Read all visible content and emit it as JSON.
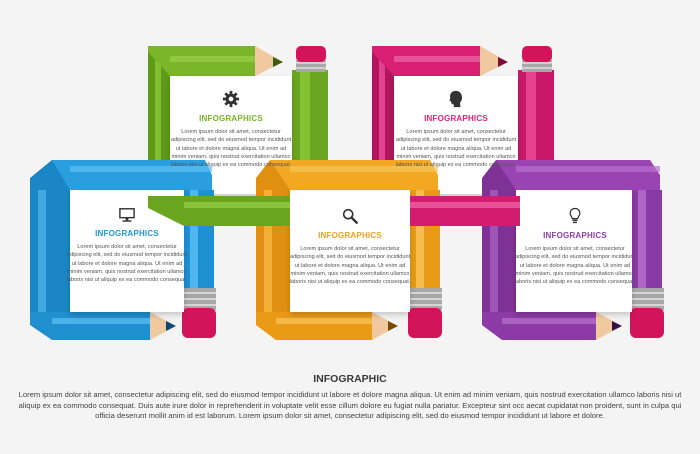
{
  "colors": {
    "green": "#78b428",
    "pink": "#e0207a",
    "blue": "#1f96d8",
    "orange": "#f0a020",
    "purple": "#8e3da8",
    "eraser": "#d4145a",
    "metal": "#a8a8a8",
    "wood": "#f1c9a0"
  },
  "cards": [
    {
      "id": "green",
      "icon": "gear-icon",
      "title": "INFOGRAPHICS",
      "text": "Lorem ipsum dolor sit amet, consectetur adipiscing elit, sed do eiusmod tempor incididunt ut labore et dolore magna aliqua. Ut enim ad minim veniam, quis nostrud exercitation ullamco laboris nisi ut aliquip ex ea commodo consequat."
    },
    {
      "id": "pink",
      "icon": "person-head-icon",
      "title": "INFOGRAPHICS",
      "text": "Lorem ipsum dolor sit amet, consectetur adipiscing elit, sed do eiusmod tempor incididunt ut labore et dolore magna aliqua. Ut enim ad minim veniam, quis nostrud exercitation ullamco laboris nisi ut aliquip ex ea commodo consequat."
    },
    {
      "id": "blue",
      "icon": "monitor-icon",
      "title": "INFOGRAPHICS",
      "text": "Lorem ipsum dolor sit amet, consectetur adipiscing elit, sed do eiusmod tempor incididunt ut labore et dolore magna aliqua. Ut enim ad minim veniam, quis nostrud exercitation ullamco laboris nisi ut aliquip ex ea commodo consequat."
    },
    {
      "id": "orange",
      "icon": "magnifier-icon",
      "title": "INFOGRAPHICS",
      "text": "Lorem ipsum dolor sit amet, consectetur adipiscing elit, sed do eiusmod tempor incididunt ut labore et dolore magna aliqua. Ut enim ad minim veniam, quis nostrud exercitation ullamco laboris nisi ut aliquip ex ea commodo consequat."
    },
    {
      "id": "purple",
      "icon": "lightbulb-icon",
      "title": "INFOGRAPHICS",
      "text": "Lorem ipsum dolor sit amet, consectetur adipiscing elit, sed do eiusmod tempor incididunt ut labore et dolore magna aliqua. Ut enim ad minim veniam, quis nostrud exercitation ullamco laboris nisi ut aliquip ex ea commodo consequat."
    }
  ],
  "footer": {
    "title": "INFOGRAPHIC",
    "body": "Lorem ipsum dolor sit amet, consectetur adipiscing elit, sed do eiusmod tempor incididunt ut labore et dolore magna aliqua. Ut enim ad minim veniam, quis nostrud exercitation ullamco laboris nisi ut aliquip ex ea commodo consequat. Duis aute irure dolor in reprehenderit in voluptate velit esse cillum dolore eu fugiat nulla pariatur. Excepteur sint occ aecat cupidatat non proident, sunt in culpa qui officia deserunt mollit anim id est laborum. Lorem ipsum dolor sit amet, consectetur adipiscing elit, sed do eiusmod tempor incididunt ut labore et dolore."
  }
}
